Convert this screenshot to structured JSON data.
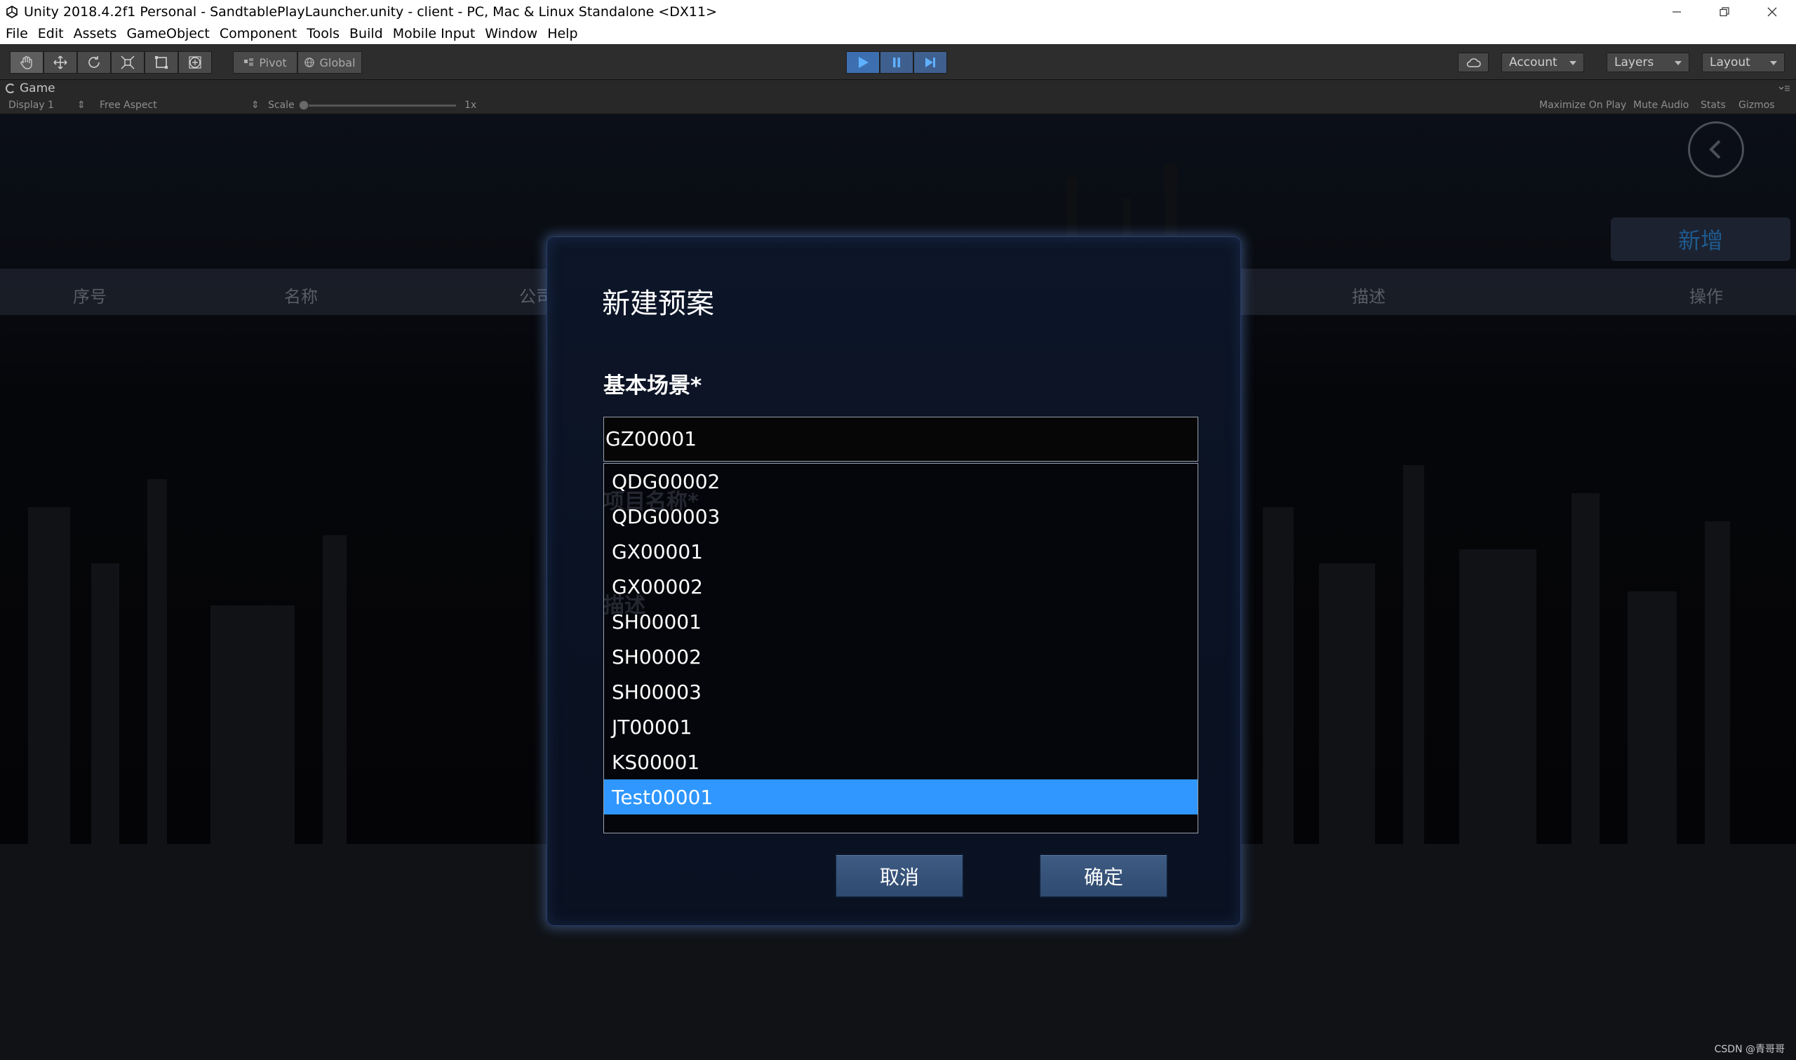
{
  "window": {
    "title": "Unity 2018.4.2f1 Personal - SandtablePlayLauncher.unity - client - PC, Mac & Linux Standalone <DX11>"
  },
  "menu": [
    "File",
    "Edit",
    "Assets",
    "GameObject",
    "Component",
    "Tools",
    "Build",
    "Mobile Input",
    "Window",
    "Help"
  ],
  "toolbar": {
    "pivot": "Pivot",
    "global": "Global",
    "account": "Account",
    "layers": "Layers",
    "layout": "Layout"
  },
  "game_view": {
    "tab": "Game",
    "display": "Display 1",
    "aspect": "Free Aspect",
    "scale_label": "Scale",
    "scale_value": "1x",
    "maximize": "Maximize On Play",
    "mute": "Mute Audio",
    "stats": "Stats",
    "gizmos": "Gizmos"
  },
  "background": {
    "add_button": "新增",
    "columns": [
      "序号",
      "名称",
      "公司",
      "描述",
      "操作"
    ],
    "ghost_labels": [
      "项目名称*",
      "描述"
    ]
  },
  "modal": {
    "title": "新建预案",
    "scene_label": "基本场景*",
    "selected_value": "GZ00001",
    "options": [
      "QDG00002",
      "QDG00003",
      "GX00001",
      "GX00002",
      "SH00001",
      "SH00002",
      "SH00003",
      "JT00001",
      "KS00001",
      "Test00001"
    ],
    "highlighted_option": "Test00001",
    "cancel": "取消",
    "confirm": "确定"
  },
  "watermark": "CSDN @青哥哥",
  "colors": {
    "highlight": "#2f97ff",
    "play_button": "#3d6fb0",
    "modal_bg": "#0a1223",
    "button_bg": "#34506f"
  }
}
